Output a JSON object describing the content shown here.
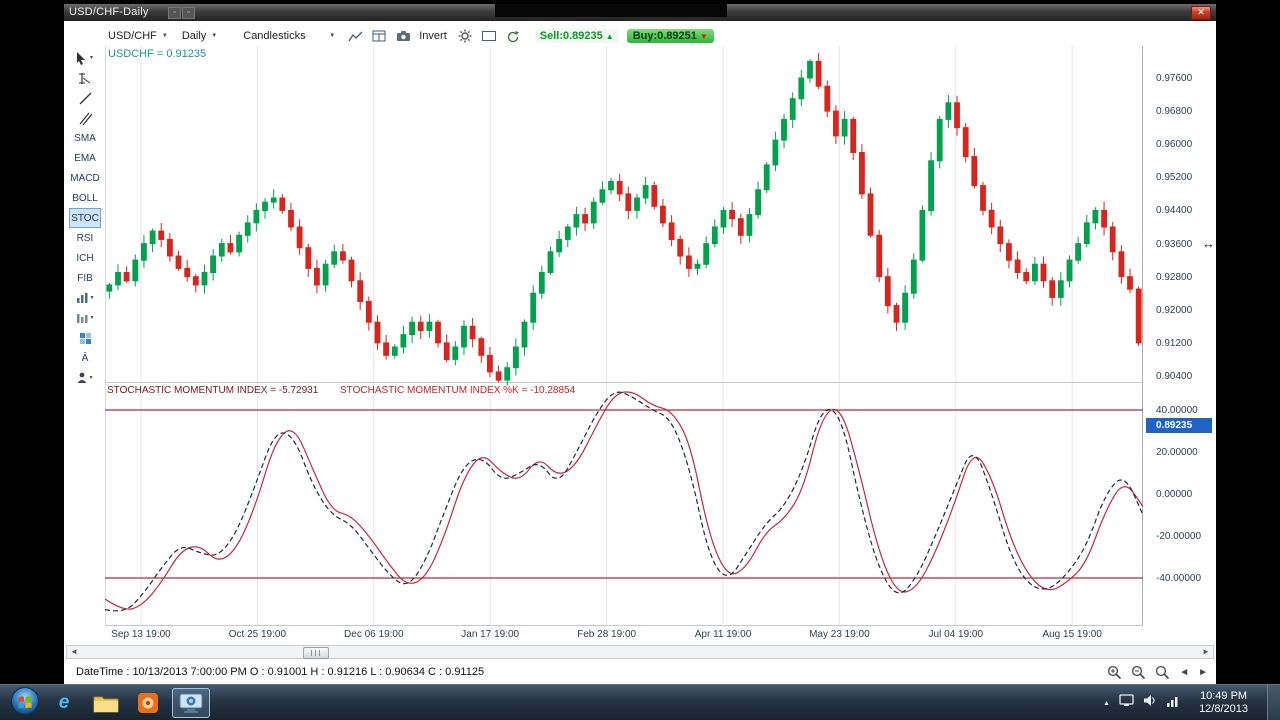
{
  "window": {
    "title": "USD/CHF-Daily"
  },
  "icons": {
    "caret": "▼",
    "up_triangle": "▲",
    "down_triangle": "▼",
    "left_arrow": "◄",
    "right_arrow": "►",
    "resize_cursor": "↔",
    "tray_chevron": "▲",
    "close": "✕"
  },
  "toolbar": {
    "symbol": "USD/CHF",
    "period": "Daily",
    "chart_type": "Candlesticks",
    "invert_label": "Invert",
    "sell_label": "Sell:0.89235",
    "buy_label": "Buy:0.89251"
  },
  "toolbox": {
    "indicators": [
      "SMA",
      "EMA",
      "MACD",
      "BOLL",
      "STOC",
      "RSI",
      "ICH",
      "FIB"
    ],
    "selected": "STOC",
    "text_tool_label": "Ā"
  },
  "chart": {
    "symbol_label": "USDCHF = 0.91235",
    "smi_d_label": "STOCHASTIC MOMENTUM INDEX = -5.72931",
    "smi_k_label": "STOCHASTIC MOMENTUM INDEX %K = -10.28854",
    "current_price": "0.89235"
  },
  "status": {
    "text": "DateTime : 10/13/2013 7:00:00 PM O : 0.91001 H : 0.91216 L : 0.90634 C : 0.91125"
  },
  "taskbar": {
    "time": "10:49 PM",
    "date": "12/8/2013"
  },
  "chart_data": [
    {
      "type": "candlestick",
      "pair": "USD/CHF",
      "timeframe": "Daily",
      "up_color": "#00a24d",
      "down_color": "#d9251d",
      "ylim": [
        0.904,
        0.976
      ],
      "y_ticks": [
        "0.97600",
        "0.96800",
        "0.96000",
        "0.95200",
        "0.94400",
        "0.93600",
        "0.92800",
        "0.92000",
        "0.91200",
        "0.90400"
      ],
      "x_ticks": [
        "Sep 13 19:00",
        "Oct 25 19:00",
        "Dec 06 19:00",
        "Jan 17 19:00",
        "Feb 28 19:00",
        "Apr 11 19:00",
        "May 23 19:00",
        "Jul 04 19:00",
        "Aug 15 19:00"
      ],
      "closes": [
        0.926,
        0.929,
        0.927,
        0.932,
        0.936,
        0.939,
        0.937,
        0.933,
        0.93,
        0.928,
        0.926,
        0.929,
        0.933,
        0.936,
        0.934,
        0.938,
        0.941,
        0.944,
        0.946,
        0.947,
        0.944,
        0.94,
        0.935,
        0.93,
        0.926,
        0.931,
        0.934,
        0.932,
        0.927,
        0.922,
        0.917,
        0.912,
        0.909,
        0.911,
        0.914,
        0.917,
        0.915,
        0.917,
        0.912,
        0.908,
        0.911,
        0.916,
        0.913,
        0.909,
        0.905,
        0.903,
        0.906,
        0.911,
        0.917,
        0.924,
        0.929,
        0.934,
        0.937,
        0.94,
        0.943,
        0.941,
        0.946,
        0.949,
        0.951,
        0.948,
        0.944,
        0.947,
        0.95,
        0.945,
        0.941,
        0.937,
        0.933,
        0.93,
        0.931,
        0.936,
        0.94,
        0.944,
        0.942,
        0.938,
        0.943,
        0.949,
        0.955,
        0.961,
        0.966,
        0.971,
        0.976,
        0.98,
        0.974,
        0.968,
        0.962,
        0.966,
        0.958,
        0.948,
        0.938,
        0.928,
        0.921,
        0.917,
        0.924,
        0.932,
        0.944,
        0.956,
        0.966,
        0.97,
        0.964,
        0.957,
        0.95,
        0.944,
        0.94,
        0.936,
        0.932,
        0.929,
        0.927,
        0.931,
        0.927,
        0.923,
        0.927,
        0.932,
        0.936,
        0.941,
        0.944,
        0.94,
        0.934,
        0.928,
        0.925,
        0.912
      ]
    },
    {
      "type": "line",
      "name": "Stochastic Momentum Index",
      "y_ticks": [
        "40.00000",
        "20.00000",
        "0.00000",
        "-20.00000",
        "-40.00000"
      ],
      "hlines": [
        40,
        -40
      ],
      "hline_color": "#a83340",
      "series": [
        {
          "name": "SMI",
          "color": "#c5293a",
          "style": "solid",
          "values": [
            -50,
            -56,
            -53,
            -42,
            -27,
            -24,
            -33,
            -26,
            -5,
            25,
            33,
            12,
            -8,
            -10,
            -20,
            -33,
            -44,
            -40,
            -20,
            8,
            20,
            10,
            6,
            18,
            8,
            14,
            32,
            48,
            49,
            42,
            40,
            25,
            -20,
            -40,
            -35,
            -18,
            -12,
            2,
            38,
            42,
            10,
            -28,
            -48,
            -45,
            -28,
            -5,
            22,
            8,
            -22,
            -40,
            -47,
            -42,
            -33,
            -8,
            7,
            -6
          ]
        },
        {
          "name": "SMI %K",
          "color": "#1c2b3a",
          "style": "dashed",
          "values": [
            -55,
            -57,
            -48,
            -35,
            -24,
            -28,
            -30,
            -18,
            5,
            30,
            28,
            4,
            -10,
            -14,
            -26,
            -38,
            -45,
            -32,
            -8,
            14,
            18,
            6,
            10,
            16,
            4,
            20,
            38,
            50,
            46,
            40,
            36,
            12,
            -30,
            -42,
            -28,
            -14,
            -6,
            12,
            42,
            38,
            -4,
            -36,
            -50,
            -40,
            -20,
            2,
            24,
            0,
            -30,
            -44,
            -46,
            -38,
            -25,
            0,
            10,
            -10
          ]
        }
      ]
    }
  ]
}
